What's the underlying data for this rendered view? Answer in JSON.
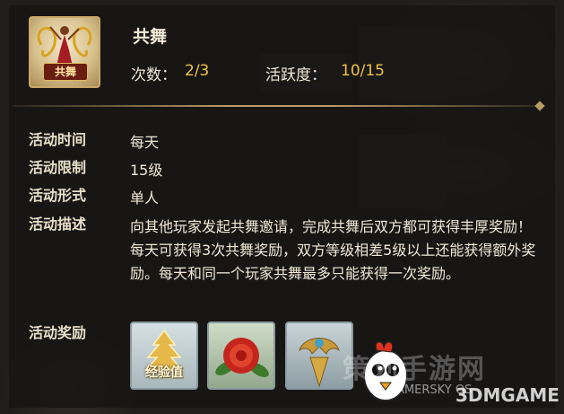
{
  "activity": {
    "name": "共舞",
    "icon_tag": "共舞",
    "icon": "dancer-icon",
    "count_label": "次数：",
    "count_value": "2/3",
    "activity_label": "活跃度：",
    "activity_value": "10/15"
  },
  "details": {
    "time_label": "活动时间",
    "time_value": "每天",
    "limit_label": "活动限制",
    "limit_value": "15级",
    "form_label": "活动形式",
    "form_value": "单人",
    "desc_label": "活动描述",
    "desc_value": "向其他玩家发起共舞邀请，完成共舞后双方都可获得丰厚奖励！每天可获得3次共舞奖励，双方等级相差5级以上还能获得额外奖励。每天和同一个玩家共舞最多只能获得一次奖励。",
    "reward_label": "活动奖励"
  },
  "rewards": [
    {
      "icon": "experience-icon",
      "label": "经验值"
    },
    {
      "icon": "camellia-flower-icon",
      "label": ""
    },
    {
      "icon": "golden-dragon-ornament-icon",
      "label": ""
    }
  ],
  "watermark": {
    "big": "策划手游网",
    "small": "GAMERSKY OS",
    "brand": "3DMGAME"
  },
  "colors": {
    "accent_gold": "#f0c241",
    "frame_gold": "#caa86a",
    "text": "#f1e9d6"
  }
}
